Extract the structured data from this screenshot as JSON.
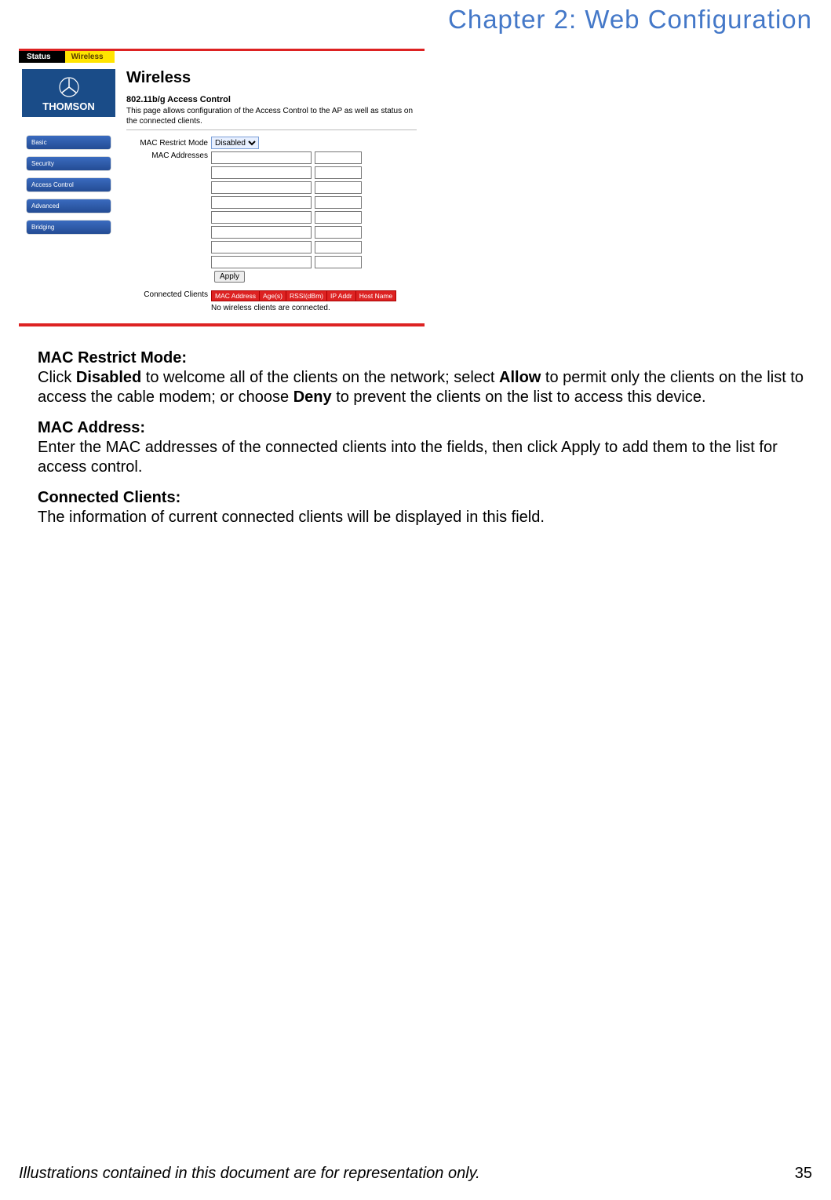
{
  "chapter_title": "Chapter 2: Web Configuration",
  "screenshot": {
    "topnav": {
      "status": "Status",
      "wireless": "Wireless"
    },
    "brand": "THOMSON",
    "sidenav": [
      "Basic",
      "Security",
      "Access Control",
      "Advanced",
      "Bridging"
    ],
    "panel_title": "Wireless",
    "panel_subtitle": "802.11b/g Access Control",
    "panel_desc": "This page allows configuration of the Access Control to the AP as well as status on the connected clients.",
    "label_restrict_mode": "MAC Restrict Mode",
    "restrict_mode_value": "Disabled",
    "label_mac_addresses": "MAC Addresses",
    "mac_rows": 8,
    "apply_label": "Apply",
    "label_connected_clients": "Connected Clients",
    "cc_headers": [
      "MAC Address",
      "Age(s)",
      "RSSI(dBm)",
      "IP Addr",
      "Host Name"
    ],
    "cc_empty": "No wireless clients are connected."
  },
  "doc": {
    "s1_h": "MAC Restrict Mode:",
    "s1_pre": "Click ",
    "s1_b1": "Disabled",
    "s1_mid1": " to welcome all of the clients on the network; select ",
    "s1_b2": "Allow",
    "s1_mid2": " to permit only the clients on the list to access the cable modem; or choose ",
    "s1_b3": "Deny",
    "s1_post": " to prevent the clients on the list to access this device.",
    "s2_h": "MAC Address:",
    "s2_p": "Enter the MAC addresses of the connected clients into the fields, then click Apply to add them to the list for access control.",
    "s3_h": "Connected Clients:",
    "s3_p": "The information of current connected clients will be displayed in this field."
  },
  "footer_text": "Illustrations contained in this document are for representation only.",
  "page_number": "35"
}
